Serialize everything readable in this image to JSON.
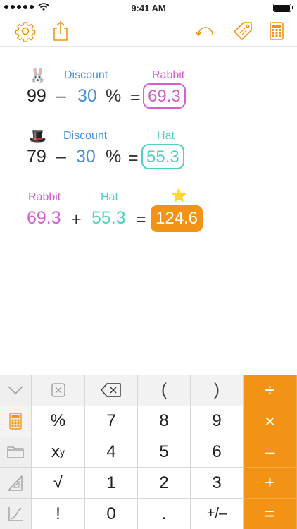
{
  "status_bar": {
    "time": "9:41 AM",
    "battery_level": 1.0
  },
  "toolbar": {
    "left_icons": [
      "settings-icon",
      "share-icon"
    ],
    "right_icons": [
      "undo-icon",
      "tag-icon",
      "calculator-icon"
    ]
  },
  "colors": {
    "accent": "#f39316",
    "blue": "#4a90d9",
    "pink": "#d35fd1",
    "teal": "#4fd1c0"
  },
  "calculations": [
    {
      "emoji": "🐰",
      "discount_label": "Discount",
      "result_label": "Rabbit",
      "base": "99",
      "operator": "–",
      "discount": "30",
      "percent": "%",
      "equals": "=",
      "result": "69.3"
    },
    {
      "emoji": "🎩",
      "discount_label": "Discount",
      "result_label": "Hat",
      "base": "79",
      "operator": "–",
      "discount": "30",
      "percent": "%",
      "equals": "=",
      "result": "55.3"
    },
    {
      "label_a": "Rabbit",
      "label_b": "Hat",
      "emoji": "⭐",
      "value_a": "69.3",
      "operator": "+",
      "value_b": "55.3",
      "equals": "=",
      "result": "124.6"
    }
  ],
  "keypad": {
    "row1": [
      "(",
      ")",
      "÷"
    ],
    "row2": [
      "%",
      "7",
      "8",
      "9",
      "×"
    ],
    "row3": [
      "x",
      "y",
      "4",
      "5",
      "6",
      "–"
    ],
    "row4": [
      "√",
      "1",
      "2",
      "3",
      "+"
    ],
    "row5": [
      "!",
      "0",
      ".",
      "+/–",
      "="
    ],
    "side_icons": [
      "chevron-down-icon",
      "calculator-icon",
      "folder-icon",
      "triangle-ruler-icon",
      "graph-icon"
    ]
  }
}
